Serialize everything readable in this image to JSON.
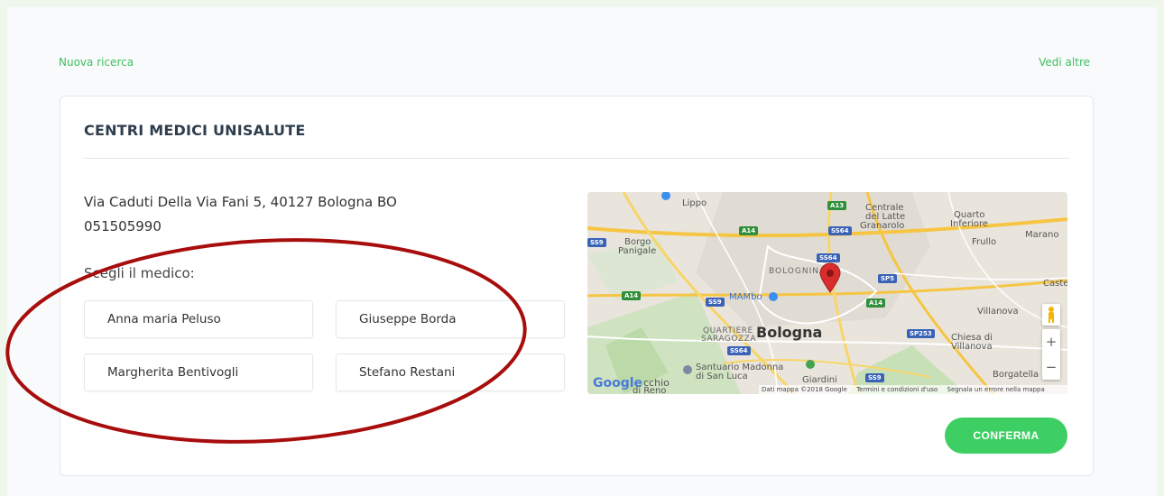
{
  "header": {
    "new_search": "Nuova ricerca",
    "see_more": "Vedi altre"
  },
  "card": {
    "title": "CENTRI MEDICI UNISALUTE",
    "address": "Via Caduti Della Via Fani 5, 40127 Bologna BO",
    "phone": "051505990",
    "choose_label": "Scegli il medico:",
    "doctors": [
      "Anna maria Peluso",
      "Giuseppe Borda",
      "Margherita Bentivogli",
      "Stefano Restani"
    ],
    "confirm_label": "CONFERMA"
  },
  "map": {
    "labels": {
      "lippo": "Lippo",
      "centrale": "Centrale",
      "del_latte": "del Latte",
      "granarolo": "Granarolo",
      "quarto": "Quarto",
      "inferiore": "Inferiore",
      "frullo": "Frullo",
      "marano": "Marano",
      "borgo": "Borgo",
      "panigale": "Panigale",
      "bolognina": "BOLOGNINA",
      "caste": "Caste",
      "mambo": "MAMbo",
      "villanova": "Villanova",
      "bologna": "Bologna",
      "quartiere": "QUARTIERE",
      "saragozza": "SARAGOZZA",
      "chiesa_di": "Chiesa di",
      "villanova2": "Villanova",
      "santuario": "Santuario Madonna",
      "di_san_luca": "di San Luca",
      "giardini": "Giardini",
      "borgatella": "Borgatella",
      "cchio": "cchio",
      "di_reno": "di Reno"
    },
    "shields": [
      "A13",
      "A14",
      "SS64",
      "SS9",
      "SS64",
      "SP5",
      "A14",
      "A14",
      "SS9",
      "SP253",
      "SS64",
      "SS9"
    ],
    "google": "Google",
    "attribution": {
      "data": "Dati mappa ©2018 Google",
      "terms": "Termini e condizioni d'uso",
      "report": "Segnala un errore nella mappa"
    },
    "zoom_in": "+",
    "zoom_out": "−"
  }
}
